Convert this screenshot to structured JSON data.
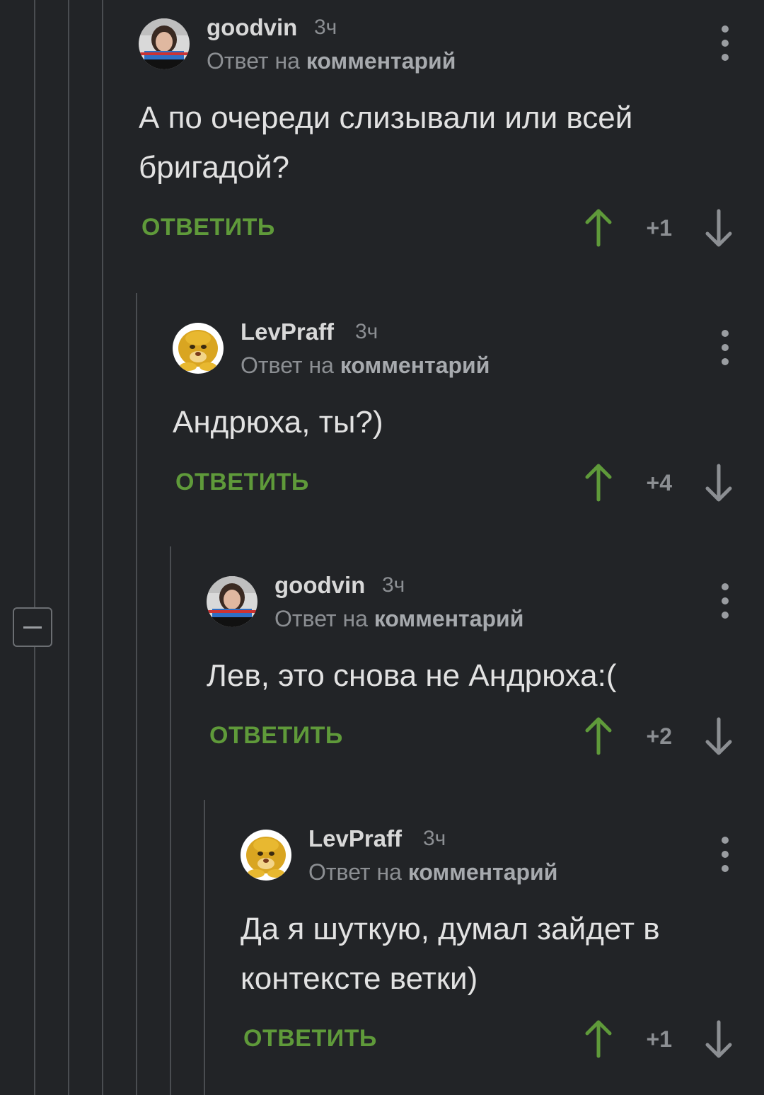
{
  "comments": [
    {
      "author": "goodvin",
      "time": "3ч",
      "reply_prefix": "Ответ на",
      "reply_link": "комментарий",
      "text": "А по очереди слизывали или всей бригадой?",
      "reply_label": "ОТВЕТИТЬ",
      "score": "+1"
    },
    {
      "author": "LevPraff",
      "time": "3ч",
      "reply_prefix": "Ответ на",
      "reply_link": "комментарий",
      "text": "Андрюха, ты?)",
      "reply_label": "ОТВЕТИТЬ",
      "score": "+4"
    },
    {
      "author": "goodvin",
      "time": "3ч",
      "reply_prefix": "Ответ на",
      "reply_link": "комментарий",
      "text": "Лев, это снова не Андрюха:(",
      "reply_label": "ОТВЕТИТЬ",
      "score": "+2"
    },
    {
      "author": "LevPraff",
      "time": "3ч",
      "reply_prefix": "Ответ на",
      "reply_link": "комментарий",
      "text": "Да я шуткую, думал зайдет в контексте ветки)",
      "reply_label": "ОТВЕТИТЬ",
      "score": "+1"
    }
  ],
  "colors": {
    "background": "#222427",
    "reply_green": "#5f9a3a",
    "upvote_green": "#5f9a3a",
    "muted_text": "#8c8f93",
    "thread_line": "#4a4d51"
  },
  "icons": {
    "collapse": "minus-square-icon",
    "more": "vertical-dots-icon",
    "upvote": "arrow-up-icon",
    "downvote": "arrow-down-icon"
  }
}
